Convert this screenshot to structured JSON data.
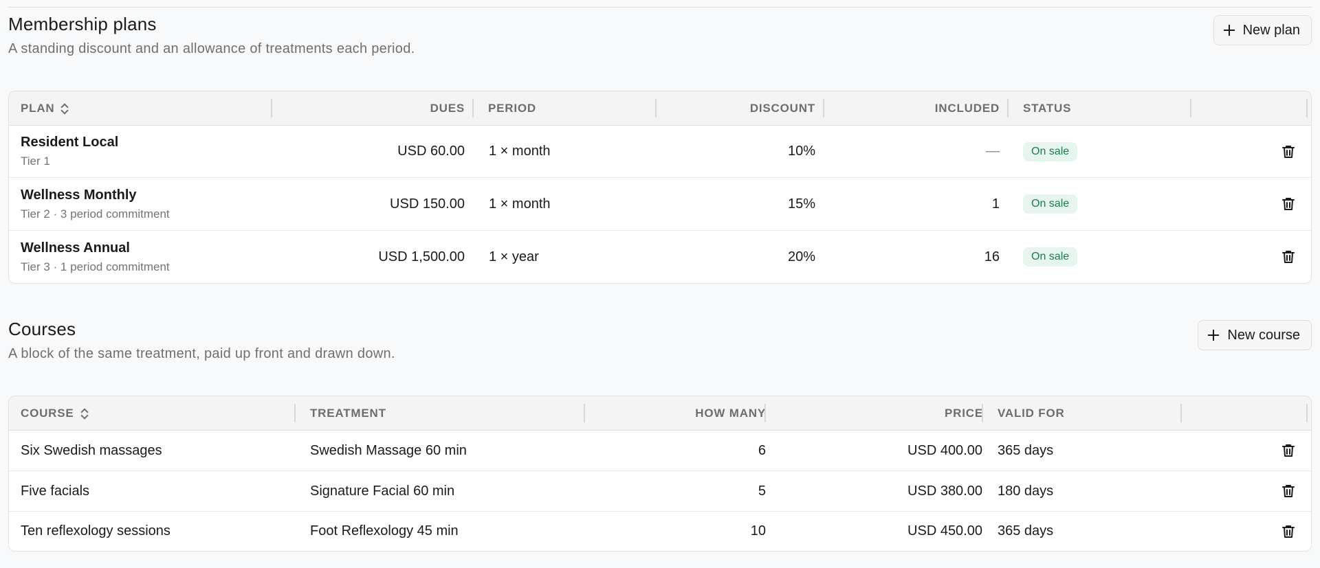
{
  "membership": {
    "title": "Membership plans",
    "subtitle": "A standing discount and an allowance of treatments each period.",
    "new_button": "New plan",
    "columns": {
      "plan": "PLAN",
      "dues": "DUES",
      "period": "PERIOD",
      "discount": "DISCOUNT",
      "included": "INCLUDED",
      "status": "STATUS"
    },
    "rows": [
      {
        "name": "Resident Local",
        "meta": "Tier 1",
        "dues": "USD 60.00",
        "period": "1 × month",
        "discount": "10%",
        "included": "—",
        "status": "On sale"
      },
      {
        "name": "Wellness Monthly",
        "meta": "Tier 2 · 3 period commitment",
        "dues": "USD 150.00",
        "period": "1 × month",
        "discount": "15%",
        "included": "1",
        "status": "On sale"
      },
      {
        "name": "Wellness Annual",
        "meta": "Tier 3 · 1 period commitment",
        "dues": "USD 1,500.00",
        "period": "1 × year",
        "discount": "20%",
        "included": "16",
        "status": "On sale"
      }
    ]
  },
  "courses": {
    "title": "Courses",
    "subtitle": "A block of the same treatment, paid up front and drawn down.",
    "new_button": "New course",
    "columns": {
      "course": "COURSE",
      "treatment": "TREATMENT",
      "how_many": "HOW MANY",
      "price": "PRICE",
      "valid_for": "VALID FOR"
    },
    "rows": [
      {
        "course": "Six Swedish massages",
        "treatment": "Swedish Massage 60 min",
        "how_many": "6",
        "price": "USD 400.00",
        "valid_for": "365 days"
      },
      {
        "course": "Five facials",
        "treatment": "Signature Facial 60 min",
        "how_many": "5",
        "price": "USD 380.00",
        "valid_for": "180 days"
      },
      {
        "course": "Ten reflexology sessions",
        "treatment": "Foot Reflexology 45 min",
        "how_many": "10",
        "price": "USD 450.00",
        "valid_for": "365 days"
      }
    ]
  },
  "icons": {
    "add": "plus-icon",
    "sort": "sort-icon",
    "delete": "trash-icon"
  },
  "colors": {
    "badge_bg": "#e6f6ee",
    "badge_text": "#1f7a4c"
  }
}
